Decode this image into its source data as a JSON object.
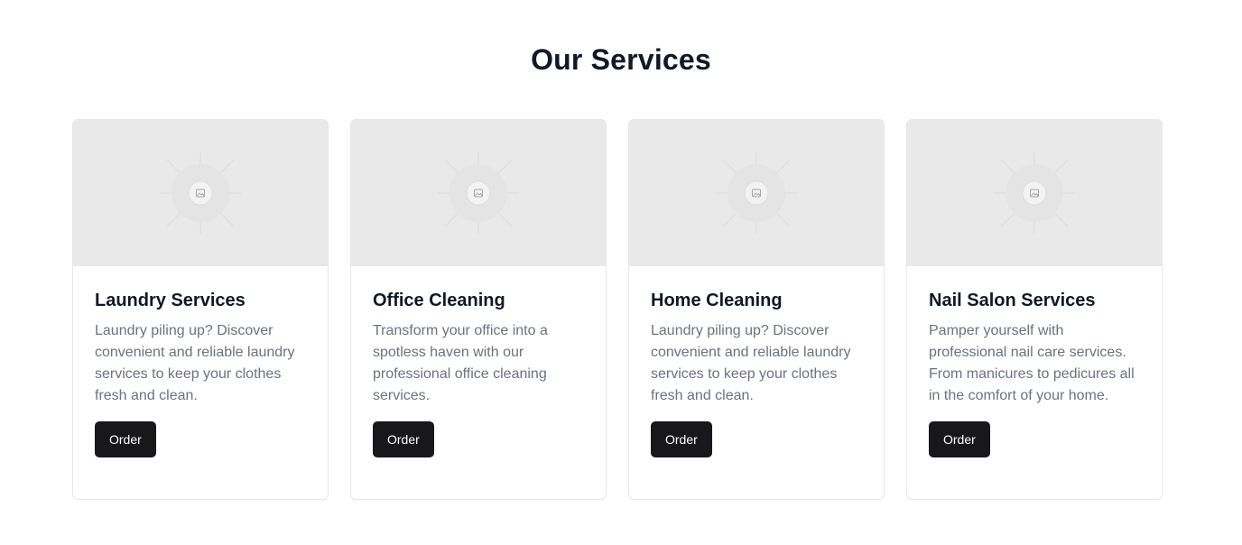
{
  "section": {
    "title": "Our Services"
  },
  "cards": [
    {
      "title": "Laundry Services",
      "description": "Laundry piling up? Discover convenient and reliable laundry services to keep your clothes fresh and clean.",
      "button_label": "Order",
      "image_icon": "image-placeholder-icon"
    },
    {
      "title": "Office Cleaning",
      "description": "Transform your office into a spotless haven with our professional office cleaning services.",
      "button_label": "Order",
      "image_icon": "image-placeholder-icon"
    },
    {
      "title": "Home Cleaning",
      "description": "Laundry piling up? Discover convenient and reliable laundry services to keep your clothes fresh and clean.",
      "button_label": "Order",
      "image_icon": "image-placeholder-icon"
    },
    {
      "title": "Nail Salon Services",
      "description": "Pamper yourself with professional nail care services. From manicures to pedicures all in the comfort of your home.",
      "button_label": "Order",
      "image_icon": "image-placeholder-icon"
    }
  ],
  "colors": {
    "button_bg": "#18181b",
    "title_text": "#111827",
    "body_text": "#6b7280",
    "image_bg": "#e9e9e9",
    "card_border": "#e5e7eb"
  }
}
